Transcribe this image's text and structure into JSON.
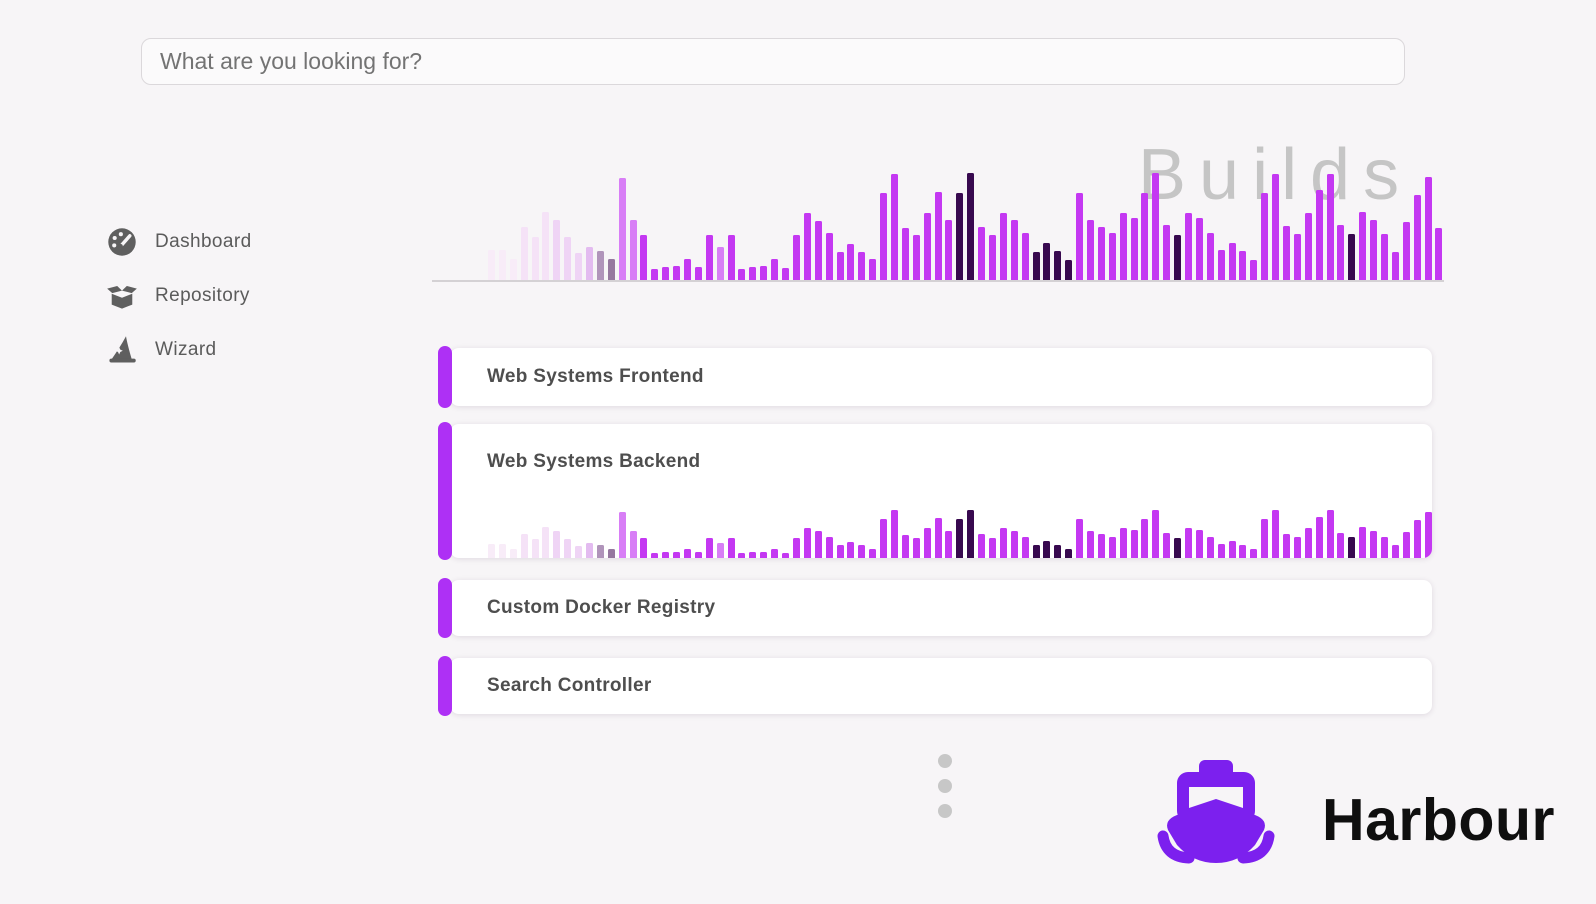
{
  "search": {
    "placeholder": "What are you looking for?"
  },
  "sidebar": {
    "items": [
      {
        "label": "Dashboard",
        "icon": "gauge-icon"
      },
      {
        "label": "Repository",
        "icon": "open-box-icon"
      },
      {
        "label": "Wizard",
        "icon": "wizard-hat-icon"
      }
    ]
  },
  "watermark_title": "Builds",
  "builds_chart": {
    "type": "bar",
    "description": "Build history sparkline (one bar per build)",
    "palette": {
      "p1": "#f8ecf8",
      "p2": "#f5e2f7",
      "p3": "#efd4f5",
      "p4": "#e3bbf0",
      "g1": "#b094ba",
      "g2": "#96789f",
      "lm": "#d87ef6",
      "m": "#c438f2",
      "d": "#38094f"
    },
    "bars": [
      [
        30,
        "p1"
      ],
      [
        30,
        "p1"
      ],
      [
        21,
        "p1"
      ],
      [
        53,
        "p2"
      ],
      [
        43,
        "p2"
      ],
      [
        68,
        "p2"
      ],
      [
        60,
        "p3"
      ],
      [
        43,
        "p3"
      ],
      [
        27,
        "p3"
      ],
      [
        33,
        "p4"
      ],
      [
        29,
        "g1"
      ],
      [
        21,
        "g2"
      ],
      [
        102,
        "lm"
      ],
      [
        60,
        "lm"
      ],
      [
        45,
        "m"
      ],
      [
        11,
        "m"
      ],
      [
        13,
        "m"
      ],
      [
        14,
        "m"
      ],
      [
        21,
        "m"
      ],
      [
        13,
        "m"
      ],
      [
        45,
        "m"
      ],
      [
        33,
        "lm"
      ],
      [
        45,
        "m"
      ],
      [
        11,
        "m"
      ],
      [
        13,
        "m"
      ],
      [
        14,
        "m"
      ],
      [
        21,
        "m"
      ],
      [
        12,
        "m"
      ],
      [
        45,
        "m"
      ],
      [
        67,
        "m"
      ],
      [
        59,
        "m"
      ],
      [
        47,
        "m"
      ],
      [
        28,
        "m"
      ],
      [
        36,
        "m"
      ],
      [
        28,
        "m"
      ],
      [
        21,
        "m"
      ],
      [
        87,
        "m"
      ],
      [
        106,
        "m"
      ],
      [
        52,
        "m"
      ],
      [
        45,
        "m"
      ],
      [
        67,
        "m"
      ],
      [
        88,
        "m"
      ],
      [
        60,
        "m"
      ],
      [
        87,
        "d"
      ],
      [
        107,
        "d"
      ],
      [
        53,
        "m"
      ],
      [
        45,
        "m"
      ],
      [
        67,
        "m"
      ],
      [
        60,
        "m"
      ],
      [
        47,
        "m"
      ],
      [
        28,
        "d"
      ],
      [
        37,
        "d"
      ],
      [
        29,
        "d"
      ],
      [
        20,
        "d"
      ],
      [
        87,
        "m"
      ],
      [
        60,
        "m"
      ],
      [
        53,
        "m"
      ],
      [
        47,
        "m"
      ],
      [
        67,
        "m"
      ],
      [
        62,
        "m"
      ],
      [
        87,
        "m"
      ],
      [
        107,
        "m"
      ],
      [
        55,
        "m"
      ],
      [
        45,
        "d"
      ],
      [
        67,
        "m"
      ],
      [
        62,
        "m"
      ],
      [
        47,
        "m"
      ],
      [
        30,
        "m"
      ],
      [
        37,
        "m"
      ],
      [
        29,
        "m"
      ],
      [
        20,
        "m"
      ],
      [
        87,
        "m"
      ],
      [
        106,
        "m"
      ],
      [
        54,
        "m"
      ],
      [
        46,
        "m"
      ],
      [
        67,
        "m"
      ],
      [
        90,
        "m"
      ],
      [
        106,
        "m"
      ],
      [
        55,
        "m"
      ],
      [
        46,
        "d"
      ],
      [
        68,
        "m"
      ],
      [
        60,
        "m"
      ],
      [
        46,
        "m"
      ],
      [
        28,
        "m"
      ],
      [
        58,
        "m"
      ],
      [
        85,
        "m"
      ],
      [
        103,
        "m"
      ],
      [
        52,
        "m"
      ]
    ],
    "mini_scale": 0.45
  },
  "projects": [
    {
      "title": "Web Systems Frontend",
      "expanded": false
    },
    {
      "title": "Web Systems Backend",
      "expanded": true
    },
    {
      "title": "Custom Docker Registry",
      "expanded": false
    },
    {
      "title": "Search Controller",
      "expanded": false
    }
  ],
  "more_indicator": {
    "dots": 3
  },
  "brand": {
    "name": "Harbour",
    "icon": "ship-icon",
    "color": "#7c20ee"
  },
  "colors": {
    "background": "#f7f5f7",
    "card": "#ffffff",
    "accent": "#ae30f5",
    "watermark": "#c5c5c5",
    "baseline": "#d4d1d4",
    "bar_magenta": "#c438f2",
    "bar_dark": "#38094f",
    "icon_gray": "#5f5f5f"
  }
}
